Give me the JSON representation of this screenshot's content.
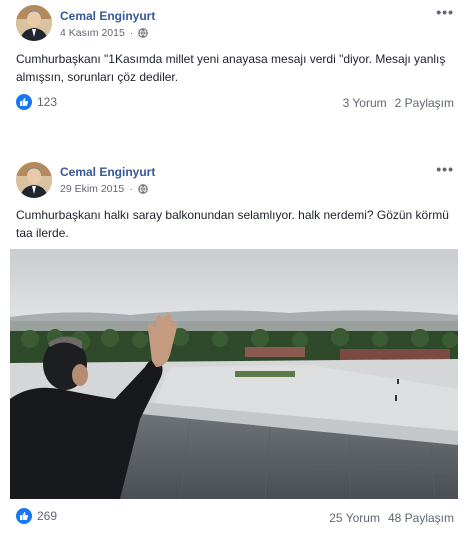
{
  "posts": [
    {
      "author": "Cemal Enginyurt",
      "date": "4 Kasım 2015",
      "text": "Cumhurbaşkanı \"1Kasımda millet yeni anayasa mesajı verdi \"diyor. Mesajı yanlış almışsın, sorunları çöz dediler.",
      "likes": "123",
      "comments": "3 Yorum",
      "shares": "2 Paylaşım"
    },
    {
      "author": "Cemal Enginyurt",
      "date": "29 Ekim 2015",
      "text": "Cumhurbaşkanı halkı saray balkonundan selamlıyor. halk nerdemi? Gözün körmü taa ilerde.",
      "likes": "269",
      "comments": "25 Yorum",
      "shares": "48 Paylaşım"
    }
  ],
  "icons": {
    "more": "more-options-icon",
    "privacy": "globe-icon",
    "like": "like-icon"
  },
  "colors": {
    "author_link": "#385898",
    "like_blue": "#1877f2",
    "meta_gray": "#616770"
  }
}
